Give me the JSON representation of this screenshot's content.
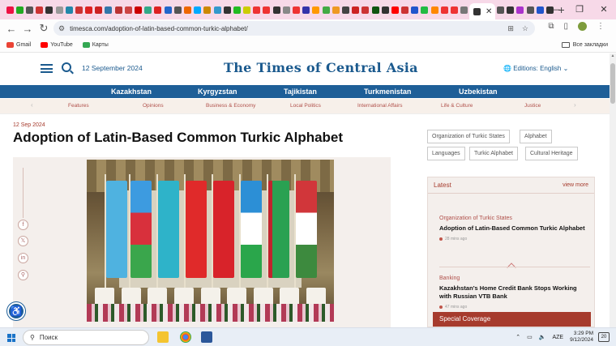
{
  "browser": {
    "active_tab_title": "",
    "tab_favicon_colors": [
      "#e14",
      "#2a2",
      "#555",
      "#c33",
      "#333",
      "#999",
      "#28a",
      "#c33",
      "#d22",
      "#c22",
      "#37a",
      "#b33",
      "#c44",
      "#c00",
      "#3a8",
      "#d22",
      "#26c",
      "#555",
      "#e60",
      "#0af",
      "#c80",
      "#39c",
      "#333",
      "#2b2",
      "#cc0",
      "#e33",
      "#e33",
      "#333",
      "#888",
      "#e33",
      "#33a",
      "#f90",
      "#4a4",
      "#e92",
      "#444",
      "#c22",
      "#c33",
      "#151",
      "#333",
      "#f00",
      "#c33",
      "#25c",
      "#2b4",
      "#f80",
      "#e33",
      "#e33",
      "#777"
    ],
    "right_tab_favicon_colors": [
      "#555",
      "#333",
      "#a3c",
      "#555",
      "#25c",
      "#333"
    ],
    "url": "timesca.com/adoption-of-latin-based-common-turkic-alphabet/",
    "bookmarks": [
      {
        "label": "Gmail",
        "color": "#ea4335"
      },
      {
        "label": "YouTube",
        "color": "#f00"
      },
      {
        "label": "Карты",
        "color": "#34a853"
      }
    ],
    "all_bookmarks_label": "Все закладки"
  },
  "site": {
    "date": "12 September 2024",
    "logo": "The Times of Central Asia",
    "editions": "Editions: English",
    "countries": [
      "Kazakhstan",
      "Kyrgyzstan",
      "Tajikistan",
      "Turkmenistan",
      "Uzbekistan"
    ],
    "sections": [
      "Features",
      "Opinions",
      "Business & Economy",
      "Local Politics",
      "International Affairs",
      "Life & Culture",
      "Justice"
    ]
  },
  "article": {
    "date": "12 Sep 2024",
    "headline": "Adoption of Latin-Based Common Turkic Alphabet",
    "share_icons": [
      "facebook-icon",
      "x-icon",
      "linkedin-icon",
      "link-icon"
    ]
  },
  "tags": [
    "Organization of Turkic States",
    "Alphabet",
    "Languages",
    "Turkic Alphabet",
    "Cultural Heritage"
  ],
  "latest": {
    "title": "Latest",
    "view_more": "view more",
    "items": [
      {
        "category": "Organization of Turkic States",
        "title": "Adoption of Latin-Based Common Turkic Alphabet",
        "time": "28 mins ago"
      },
      {
        "category": "Banking",
        "title": "Kazakhstan’s Home Credit Bank Stops Working with Russian VTB Bank",
        "time": "47 mins ago"
      }
    ],
    "special": "Special Coverage"
  },
  "taskbar": {
    "search_label": "Поиск",
    "lang": "AZE",
    "time": "3:29 PM",
    "date": "9/12/2024",
    "notifications": "20"
  },
  "colors": {
    "brand_blue": "#1e5f98",
    "accent_red": "#a63b2d",
    "tabstrip": "#f7d9e8"
  }
}
